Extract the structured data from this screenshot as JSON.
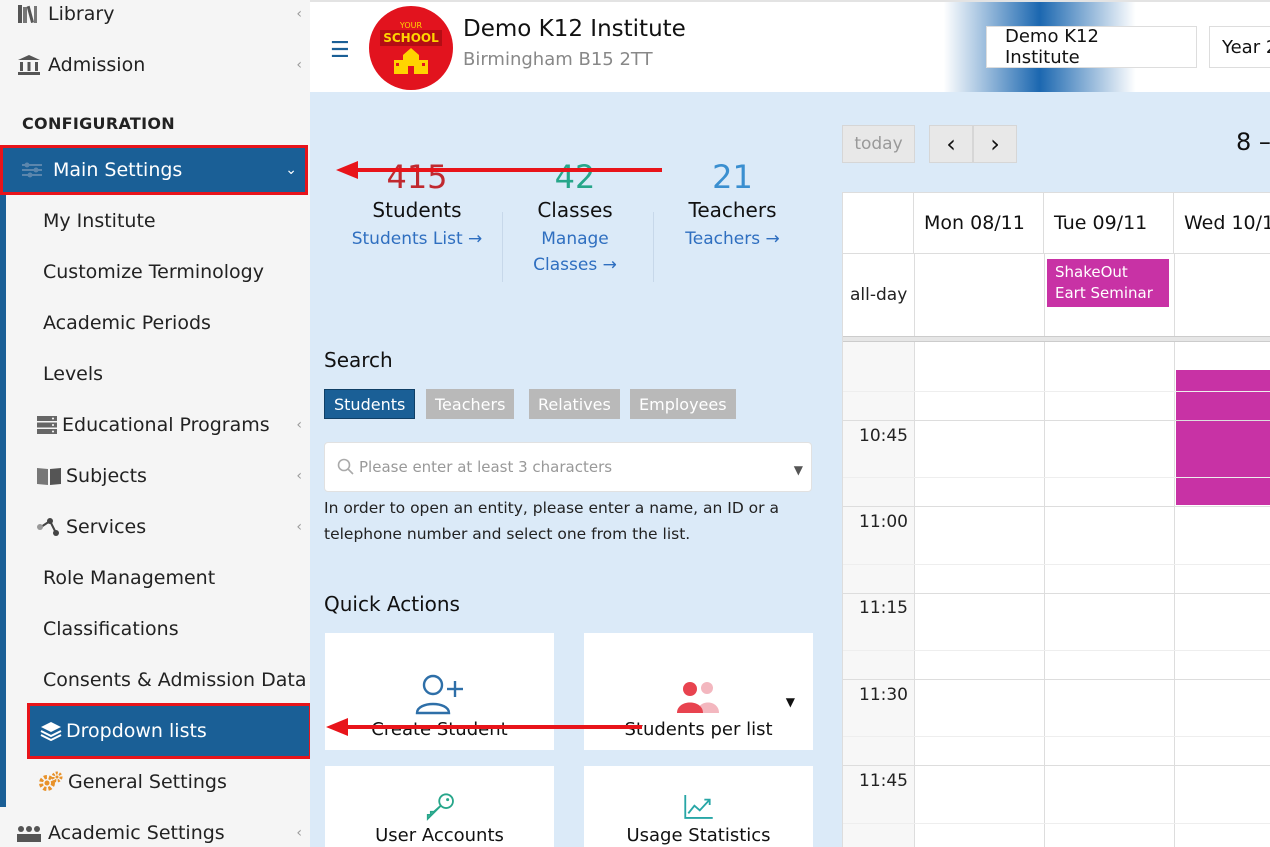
{
  "sidebar": {
    "library": "Library",
    "admission": "Admission",
    "config_header": "CONFIGURATION",
    "main_settings": "Main Settings",
    "items": [
      "My Institute",
      "Customize Terminology",
      "Academic Periods",
      "Levels",
      "Educational Programs",
      "Subjects",
      "Services",
      "Role Management",
      "Classifications",
      "Consents & Admission Data",
      "Dropdown lists",
      "General Settings"
    ],
    "academic_settings": "Academic Settings"
  },
  "header": {
    "logo_line1": "YOUR",
    "logo_line2": "SCHOOL",
    "title": "Demo K12 Institute",
    "address": "Birmingham B15 2TT",
    "institute_button": "Demo K12 Institute",
    "year_button": "Year 2"
  },
  "stats": {
    "students": {
      "num": "415",
      "label": "Students",
      "link": "Students List →",
      "color": "#c0292f"
    },
    "classes": {
      "num": "42",
      "label": "Classes",
      "link_line1": "Manage",
      "link_line2": "Classes →",
      "color": "#27a68a"
    },
    "teachers": {
      "num": "21",
      "label": "Teachers",
      "link": "Teachers →",
      "color": "#3a8fd0"
    }
  },
  "search": {
    "title": "Search",
    "filters": [
      "Students",
      "Teachers",
      "Relatives",
      "Employees"
    ],
    "placeholder": "Please enter at least 3 characters",
    "help": "In order to open an entity, please enter a name, an ID or a telephone number and select one from the list."
  },
  "quick_actions": {
    "title": "Quick Actions",
    "create_student": "Create Student",
    "students_per_list": "Students per list",
    "user_accounts": "User Accounts",
    "usage_statistics": "Usage Statistics"
  },
  "calendar": {
    "today": "today",
    "prev": "‹",
    "next": "›",
    "range": "8 –",
    "days": [
      "Mon 08/11",
      "Tue 09/11",
      "Wed 10/1"
    ],
    "all_day": "all-day",
    "event_title": "ShakeOut Eart Seminar",
    "times": [
      "10:45",
      "11:00",
      "11:15",
      "11:30",
      "11:45"
    ]
  }
}
